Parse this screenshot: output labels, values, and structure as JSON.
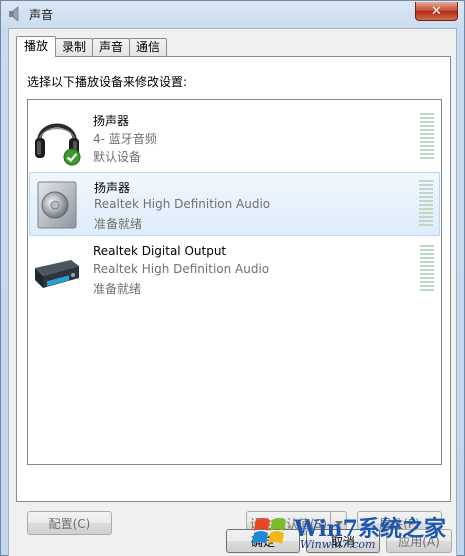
{
  "window": {
    "title": "声音",
    "close_symbol": "✕",
    "accent": "#c7462e"
  },
  "tabs": [
    {
      "label": "播放",
      "active": true
    },
    {
      "label": "录制",
      "active": false
    },
    {
      "label": "声音",
      "active": false
    },
    {
      "label": "通信",
      "active": false
    }
  ],
  "instruction": "选择以下播放设备来修改设置:",
  "devices": [
    {
      "name": "扬声器",
      "description": "4- 蓝牙音频",
      "status": "默认设备",
      "icon": "headphones-icon",
      "default": true,
      "selected": false
    },
    {
      "name": "扬声器",
      "description": "Realtek High Definition Audio",
      "status": "准备就绪",
      "icon": "speaker-icon",
      "default": false,
      "selected": true
    },
    {
      "name": "Realtek Digital Output",
      "description": "Realtek High Definition Audio",
      "status": "准备就绪",
      "icon": "digital-output-icon",
      "default": false,
      "selected": false
    }
  ],
  "buttons": {
    "configure": "配置(C)",
    "set_default": "设为默认值(S)",
    "properties": "属性(P)",
    "ok": "确定",
    "cancel": "取消",
    "apply": "应用(A)"
  },
  "watermark": {
    "logo": "Win7系统之家",
    "url": "Winwin7.com"
  }
}
